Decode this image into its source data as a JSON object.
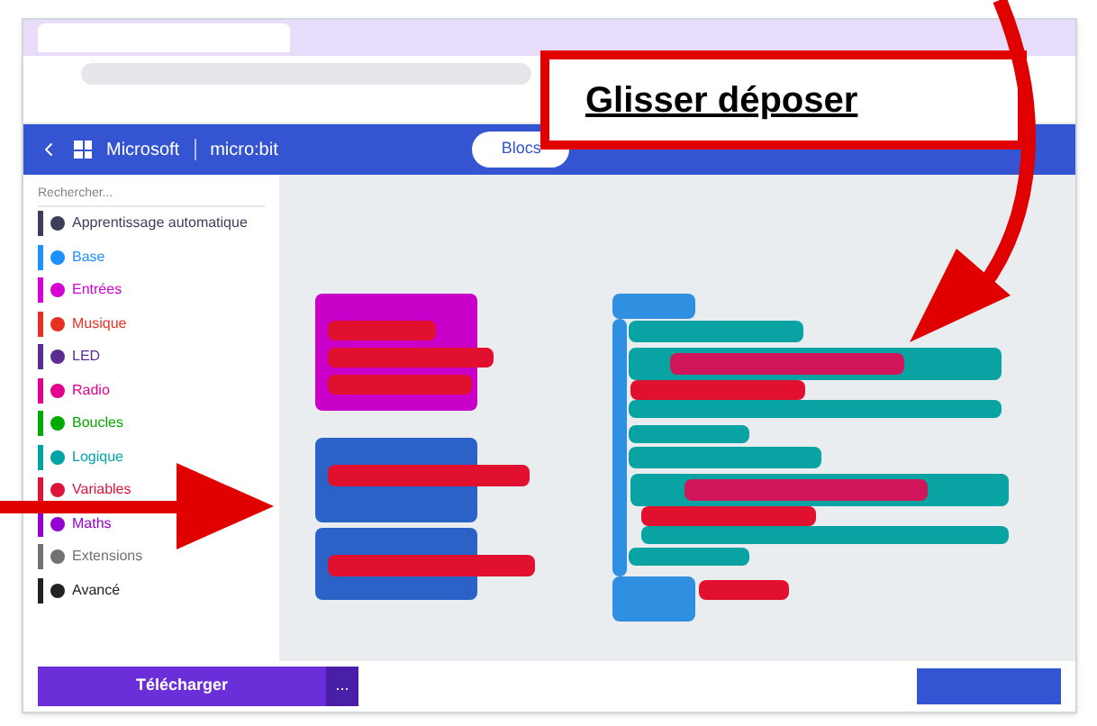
{
  "annotation": {
    "label": "Glisser déposer"
  },
  "header": {
    "brand": "Microsoft",
    "product": "micro:bit",
    "tabs": [
      {
        "label": "Blocs",
        "selected": true
      }
    ]
  },
  "sidebar": {
    "search": {
      "placeholder": "Rechercher..."
    },
    "items": [
      {
        "label": "Apprentissage automatique",
        "color": "#3d3d5c"
      },
      {
        "label": "Base",
        "color": "#1e90ff"
      },
      {
        "label": "Entrées",
        "color": "#d400d4"
      },
      {
        "label": "Musique",
        "color": "#e63022"
      },
      {
        "label": "LED",
        "color": "#5c2d91"
      },
      {
        "label": "Radio",
        "color": "#e3008c"
      },
      {
        "label": "Boucles",
        "color": "#00aa00"
      },
      {
        "label": "Logique",
        "color": "#00a4a6"
      },
      {
        "label": "Variables",
        "color": "#dc143c"
      },
      {
        "label": "Maths",
        "color": "#9400d3"
      },
      {
        "label": "Extensions",
        "color": "#717171"
      },
      {
        "label": "Avancé",
        "color": "#222222"
      }
    ]
  },
  "footer": {
    "download": "Télécharger",
    "more": "..."
  }
}
